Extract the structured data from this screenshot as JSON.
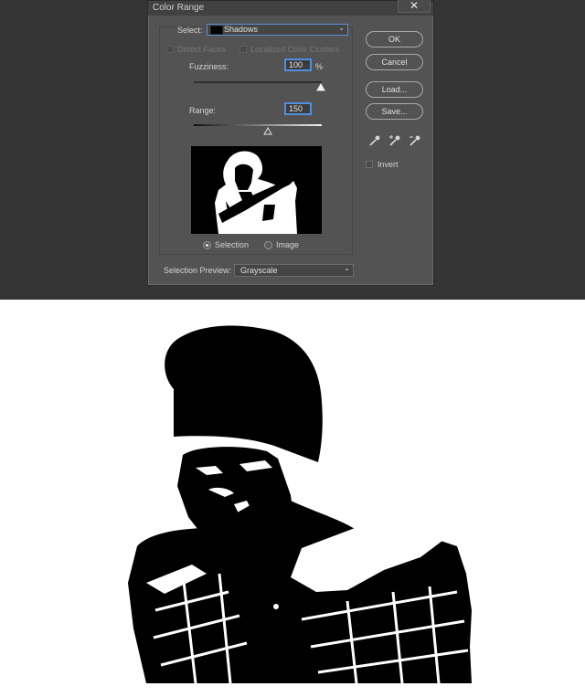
{
  "dialog": {
    "title": "Color Range",
    "close_glyph": "✕",
    "select_label": "Select:",
    "select_value": "Shadows",
    "detect_faces": "Detect Faces",
    "localized": "Localized Color Clusters",
    "fuzziness_label": "Fuzziness:",
    "fuzziness_value": "100",
    "fuzziness_unit": "%",
    "range_label": "Range:",
    "range_value": "150",
    "radio_selection": "Selection",
    "radio_image": "Image",
    "preview_label": "Selection Preview:",
    "preview_value": "Grayscale",
    "buttons": {
      "ok": "OK",
      "reset": "Cancel",
      "load": "Load...",
      "save": "Save..."
    },
    "invert": "Invert"
  },
  "icons": {
    "eyedroppers": [
      "eyedropper-icon",
      "eyedropper-plus-icon",
      "eyedropper-minus-icon"
    ],
    "chevron": "chevron-down-icon"
  }
}
